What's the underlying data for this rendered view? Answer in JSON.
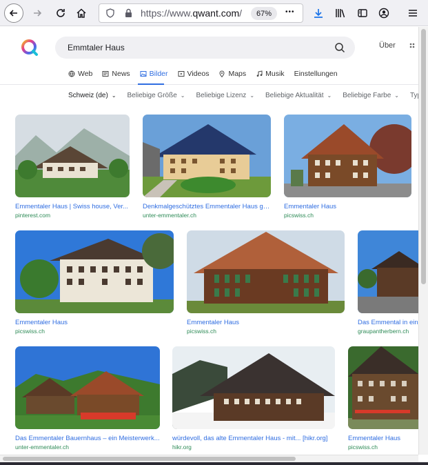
{
  "browser": {
    "url_scheme": "https://www.",
    "url_host": "qwant.com",
    "url_rest": "/",
    "zoom": "67%",
    "more_label": "•••"
  },
  "header": {
    "search_value": "Emmtaler Haus",
    "ueber": "Über"
  },
  "tabs": [
    {
      "label": "Web",
      "icon": "globe-icon"
    },
    {
      "label": "News",
      "icon": "news-icon"
    },
    {
      "label": "Bilder",
      "icon": "image-icon",
      "active": true
    },
    {
      "label": "Videos",
      "icon": "video-icon"
    },
    {
      "label": "Maps",
      "icon": "map-pin-icon"
    },
    {
      "label": "Musik",
      "icon": "music-icon"
    },
    {
      "label": "Einstellungen",
      "icon": ""
    }
  ],
  "filters": [
    "Schweiz (de)",
    "Beliebige Größe",
    "Beliebige Lizenz",
    "Beliebige Aktualität",
    "Beliebige Farbe",
    "Typ"
  ],
  "results": [
    {
      "title": "Emmentaler Haus | Swiss house, Ver...",
      "source": "pinterest.com"
    },
    {
      "title": "Denkmalgeschütztes Emmentaler Haus ge...",
      "source": "unter-emmentaler.ch"
    },
    {
      "title": "Emmentaler Haus",
      "source": "picswiss.ch"
    },
    {
      "title": "Emmentaler Haus",
      "source": "picswiss.ch"
    },
    {
      "title": "Emmentaler Haus",
      "source": "picswiss.ch"
    },
    {
      "title": "Das Emmental in eine",
      "source": "graupantherbern.ch"
    },
    {
      "title": "Das Emmentaler Bauernhaus – ein Meisterwerk...",
      "source": "unter-emmentaler.ch"
    },
    {
      "title": "würdevoll, das alte Emmentaler Haus - mit... [hikr.org]",
      "source": "hikr.org"
    },
    {
      "title": "Emmentaler Haus",
      "source": "picswiss.ch"
    }
  ],
  "colors": {
    "accent": "#2f6de1",
    "source": "#2e8b57"
  }
}
